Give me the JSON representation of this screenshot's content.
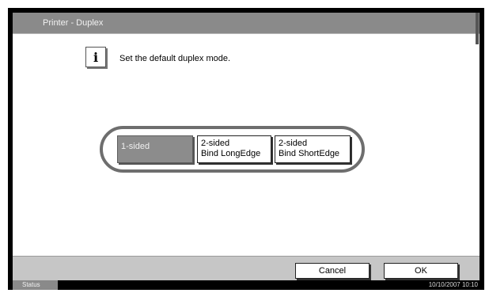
{
  "window": {
    "title": "Printer - Duplex"
  },
  "message": {
    "text": "Set the default duplex mode."
  },
  "options": [
    {
      "line1": "1-sided",
      "line2": "",
      "selected": true
    },
    {
      "line1": "2-sided",
      "line2": "Bind LongEdge",
      "selected": false
    },
    {
      "line1": "2-sided",
      "line2": "Bind ShortEdge",
      "selected": false
    }
  ],
  "footer": {
    "cancel_label": "Cancel",
    "ok_label": "OK"
  },
  "status": {
    "label": "Status",
    "datetime": "10/10/2007   10:10"
  },
  "colors": {
    "title_bar": "#8a8a8a",
    "selected_option": "#8c8c8c",
    "footer": "#c6c6c6"
  },
  "icons": {
    "info": "info-icon"
  }
}
